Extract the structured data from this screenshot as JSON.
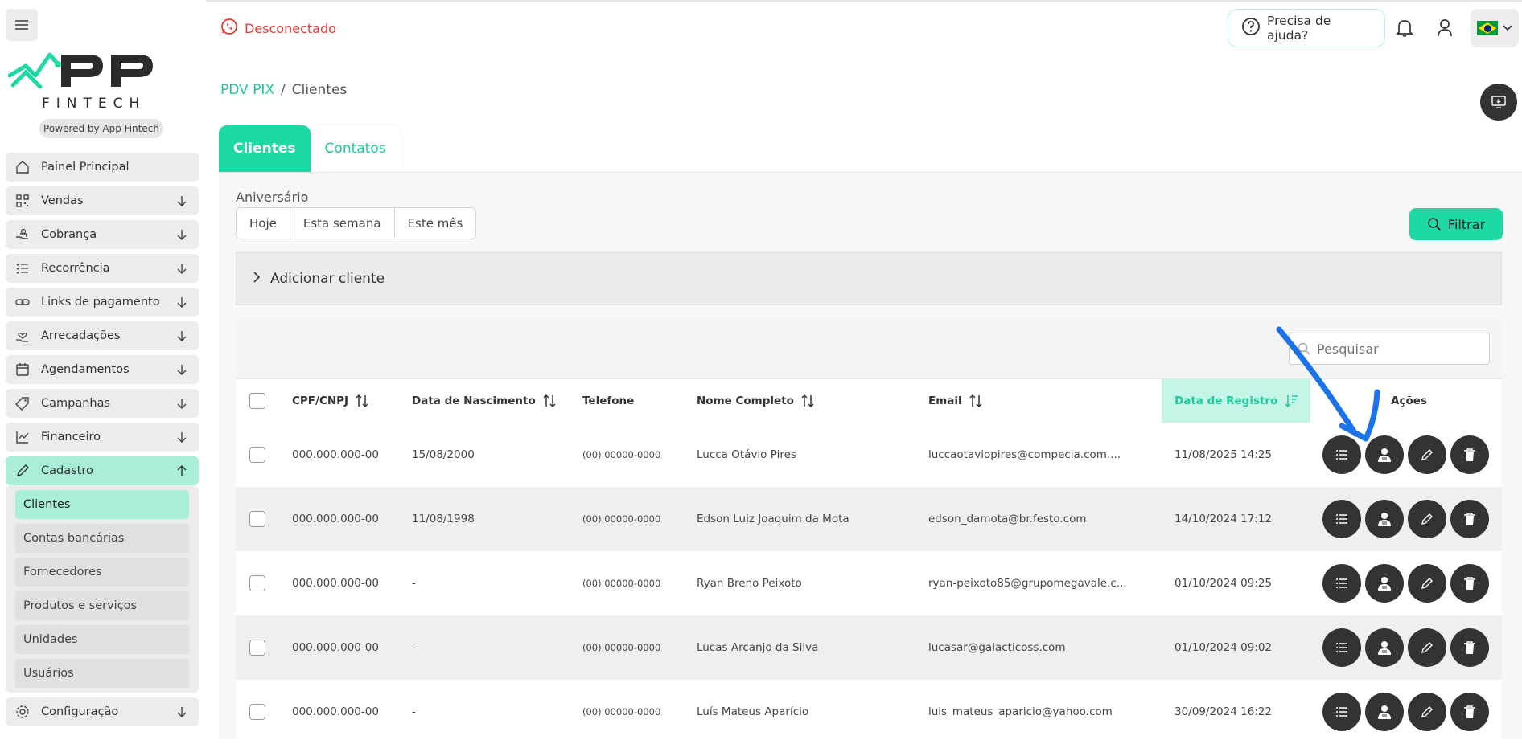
{
  "header": {
    "status": "Desconectado",
    "help_label": "Precisa de ajuda?"
  },
  "sidebar": {
    "brand_sub": "FINTECH",
    "powered_by": "Powered by App Fintech",
    "items": [
      {
        "label": "Painel Principal",
        "icon": "home-icon"
      },
      {
        "label": "Vendas",
        "icon": "qr-icon"
      },
      {
        "label": "Cobrança",
        "icon": "hand-money-icon"
      },
      {
        "label": "Recorrência",
        "icon": "list-check-icon"
      },
      {
        "label": "Links de pagamento",
        "icon": "link-icon"
      },
      {
        "label": "Arrecadações",
        "icon": "donation-icon"
      },
      {
        "label": "Agendamentos",
        "icon": "calendar-icon"
      },
      {
        "label": "Campanhas",
        "icon": "tag-icon"
      },
      {
        "label": "Financeiro",
        "icon": "chart-line-icon"
      },
      {
        "label": "Cadastro",
        "icon": "pencil-icon"
      }
    ],
    "cadastro_sub": [
      "Clientes",
      "Contas bancárias",
      "Fornecedores",
      "Produtos e serviços",
      "Unidades",
      "Usuários"
    ],
    "config_label": "Configuração"
  },
  "breadcrumb": {
    "parent": "PDV PIX",
    "sep": "/",
    "current": "Clientes"
  },
  "tabs": [
    "Clientes",
    "Contatos"
  ],
  "filters": {
    "aniversario_label": "Aniversário",
    "options": [
      "Hoje",
      "Esta semana",
      "Este mês"
    ],
    "filter_button": "Filtrar"
  },
  "add_client": "Adicionar cliente",
  "search": {
    "placeholder": "Pesquisar"
  },
  "table": {
    "columns": [
      "CPF/CNPJ",
      "Data de Nascimento",
      "Telefone",
      "Nome Completo",
      "Email",
      "Data de Registro",
      "Ações"
    ],
    "rows": [
      {
        "cpf": "000.000.000-00",
        "nasc": "15/08/2000",
        "tel": "(00) 00000-0000",
        "nome": "Lucca Otávio Pires",
        "email": "luccaotaviopires@compecia.com....",
        "registro": "11/08/2025 14:25"
      },
      {
        "cpf": "000.000.000-00",
        "nasc": "11/08/1998",
        "tel": "(00) 00000-0000",
        "nome": "Edson Luiz Joaquim da Mota",
        "email": "edson_damota@br.festo.com",
        "registro": "14/10/2024 17:12"
      },
      {
        "cpf": "000.000.000-00",
        "nasc": "-",
        "tel": "(00) 00000-0000",
        "nome": "Ryan Breno Peixoto",
        "email": "ryan-peixoto85@grupomegavale.c...",
        "registro": "01/10/2024 09:25"
      },
      {
        "cpf": "000.000.000-00",
        "nasc": "-",
        "tel": "(00) 00000-0000",
        "nome": "Lucas Arcanjo da Silva",
        "email": "lucasar@galacticoss.com",
        "registro": "01/10/2024 09:02"
      },
      {
        "cpf": "000.000.000-00",
        "nasc": "-",
        "tel": "(00) 00000-0000",
        "nome": "Luís Mateus Aparício",
        "email": "luis_mateus_aparicio@yahoo.com",
        "registro": "30/09/2024 16:22"
      }
    ]
  },
  "colors": {
    "accent": "#1fd9a4",
    "danger": "#e53935",
    "annotation": "#1a73e8"
  }
}
